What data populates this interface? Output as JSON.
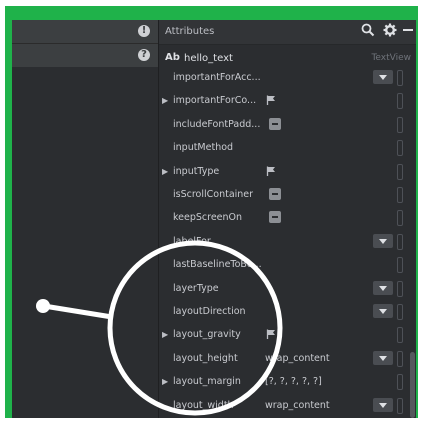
{
  "window": {
    "panel_title": "Attributes"
  },
  "left_pane": {
    "row1_icon": "!",
    "row2_icon": "?"
  },
  "toolbar": {
    "icons": [
      "search-icon",
      "gear-icon",
      "minimize-icon"
    ]
  },
  "component": {
    "badge": "Ab",
    "id": "hello_text",
    "type": "TextView"
  },
  "attributes": [
    {
      "name": "importantForAcc...",
      "expandable": false,
      "control": "dropdown",
      "value": ""
    },
    {
      "name": "importantForCo...",
      "expandable": true,
      "control": "flag",
      "value": ""
    },
    {
      "name": "includeFontPadd...",
      "expandable": false,
      "control": "minus",
      "value": ""
    },
    {
      "name": "inputMethod",
      "expandable": false,
      "control": "none",
      "value": ""
    },
    {
      "name": "inputType",
      "expandable": true,
      "control": "flag",
      "value": ""
    },
    {
      "name": "isScrollContainer",
      "expandable": false,
      "control": "minus",
      "value": ""
    },
    {
      "name": "keepScreenOn",
      "expandable": false,
      "control": "minus",
      "value": ""
    },
    {
      "name": "labelFor",
      "expandable": false,
      "control": "dropdown",
      "value": ""
    },
    {
      "name": "lastBaselineToBo...",
      "expandable": false,
      "control": "none",
      "value": ""
    },
    {
      "name": "layerType",
      "expandable": false,
      "control": "dropdown",
      "value": ""
    },
    {
      "name": "layoutDirection",
      "expandable": false,
      "control": "dropdown",
      "value": ""
    },
    {
      "name": "layout_gravity",
      "expandable": true,
      "control": "flag",
      "value": ""
    },
    {
      "name": "layout_height",
      "expandable": false,
      "control": "dropdown",
      "value": "wrap_content"
    },
    {
      "name": "layout_margin",
      "expandable": true,
      "control": "none",
      "value": "[?, ?, ?, ?, ?]"
    },
    {
      "name": "layout_width",
      "expandable": false,
      "control": "dropdown",
      "value": "wrap_content"
    }
  ],
  "colors": {
    "frame_border": "#1fb24a",
    "panel_bg": "#2b2d30",
    "annotation": "#ffffff"
  }
}
